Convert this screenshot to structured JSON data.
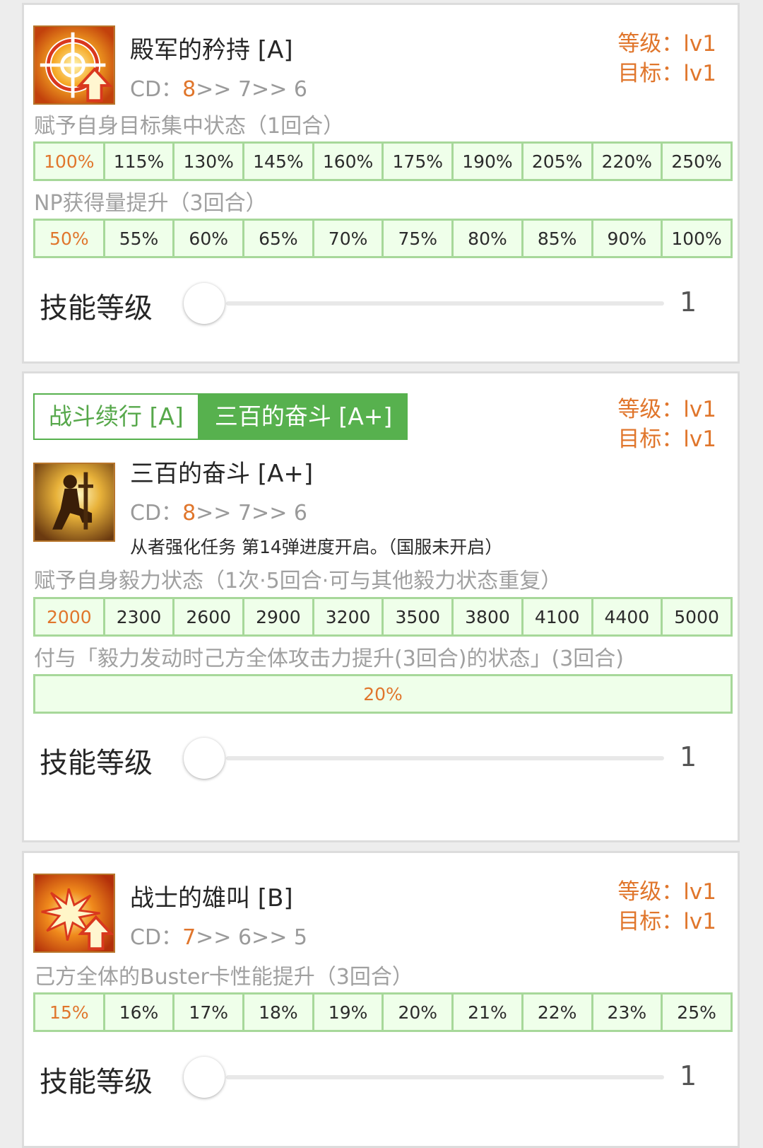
{
  "skills": [
    {
      "name": "殿军的矜持 [A]",
      "icon": "target-up-icon",
      "cd_first": "8",
      "cd_rest": ">> 7>> 6",
      "level_label": "等级：lv1",
      "target_label": "目标：lv1",
      "effects": [
        {
          "text": "赋予自身目标集中状态（1回合）",
          "values": [
            "100%",
            "115%",
            "130%",
            "145%",
            "160%",
            "175%",
            "190%",
            "205%",
            "220%",
            "250%"
          ]
        },
        {
          "text": "NP获得量提升（3回合）",
          "values": [
            "50%",
            "55%",
            "60%",
            "65%",
            "70%",
            "75%",
            "80%",
            "85%",
            "90%",
            "100%"
          ]
        }
      ],
      "slider_label": "技能等级",
      "slider_value": "1"
    },
    {
      "tabs": [
        "战斗续行 [A]",
        "三百的奋斗 [A+]"
      ],
      "active_tab": 1,
      "name": "三百的奋斗 [A+]",
      "icon": "kneeling-warrior-icon",
      "cd_first": "8",
      "cd_rest": ">> 7>> 6",
      "note": "从者强化任务 第14弹进度开启。（国服未开启）",
      "level_label": "等级：lv1",
      "target_label": "目标：lv1",
      "effects": [
        {
          "text": "赋予自身毅力状态（1次·5回合·可与其他毅力状态重复）",
          "values": [
            "2000",
            "2300",
            "2600",
            "2900",
            "3200",
            "3500",
            "3800",
            "4100",
            "4400",
            "5000"
          ]
        },
        {
          "text": "付与「毅力发动时己方全体攻击力提升(3回合)的状态」(3回合)",
          "values": [
            "20%"
          ]
        }
      ],
      "slider_label": "技能等级",
      "slider_value": "1"
    },
    {
      "name": "战士的雄叫 [B]",
      "icon": "burst-up-icon",
      "cd_first": "7",
      "cd_rest": ">> 6>> 5",
      "level_label": "等级：lv1",
      "target_label": "目标：lv1",
      "effects": [
        {
          "text": "己方全体的Buster卡性能提升（3回合）",
          "values": [
            "15%",
            "16%",
            "17%",
            "18%",
            "19%",
            "20%",
            "21%",
            "22%",
            "23%",
            "25%"
          ]
        }
      ],
      "slider_label": "技能等级",
      "slider_value": "1"
    }
  ]
}
